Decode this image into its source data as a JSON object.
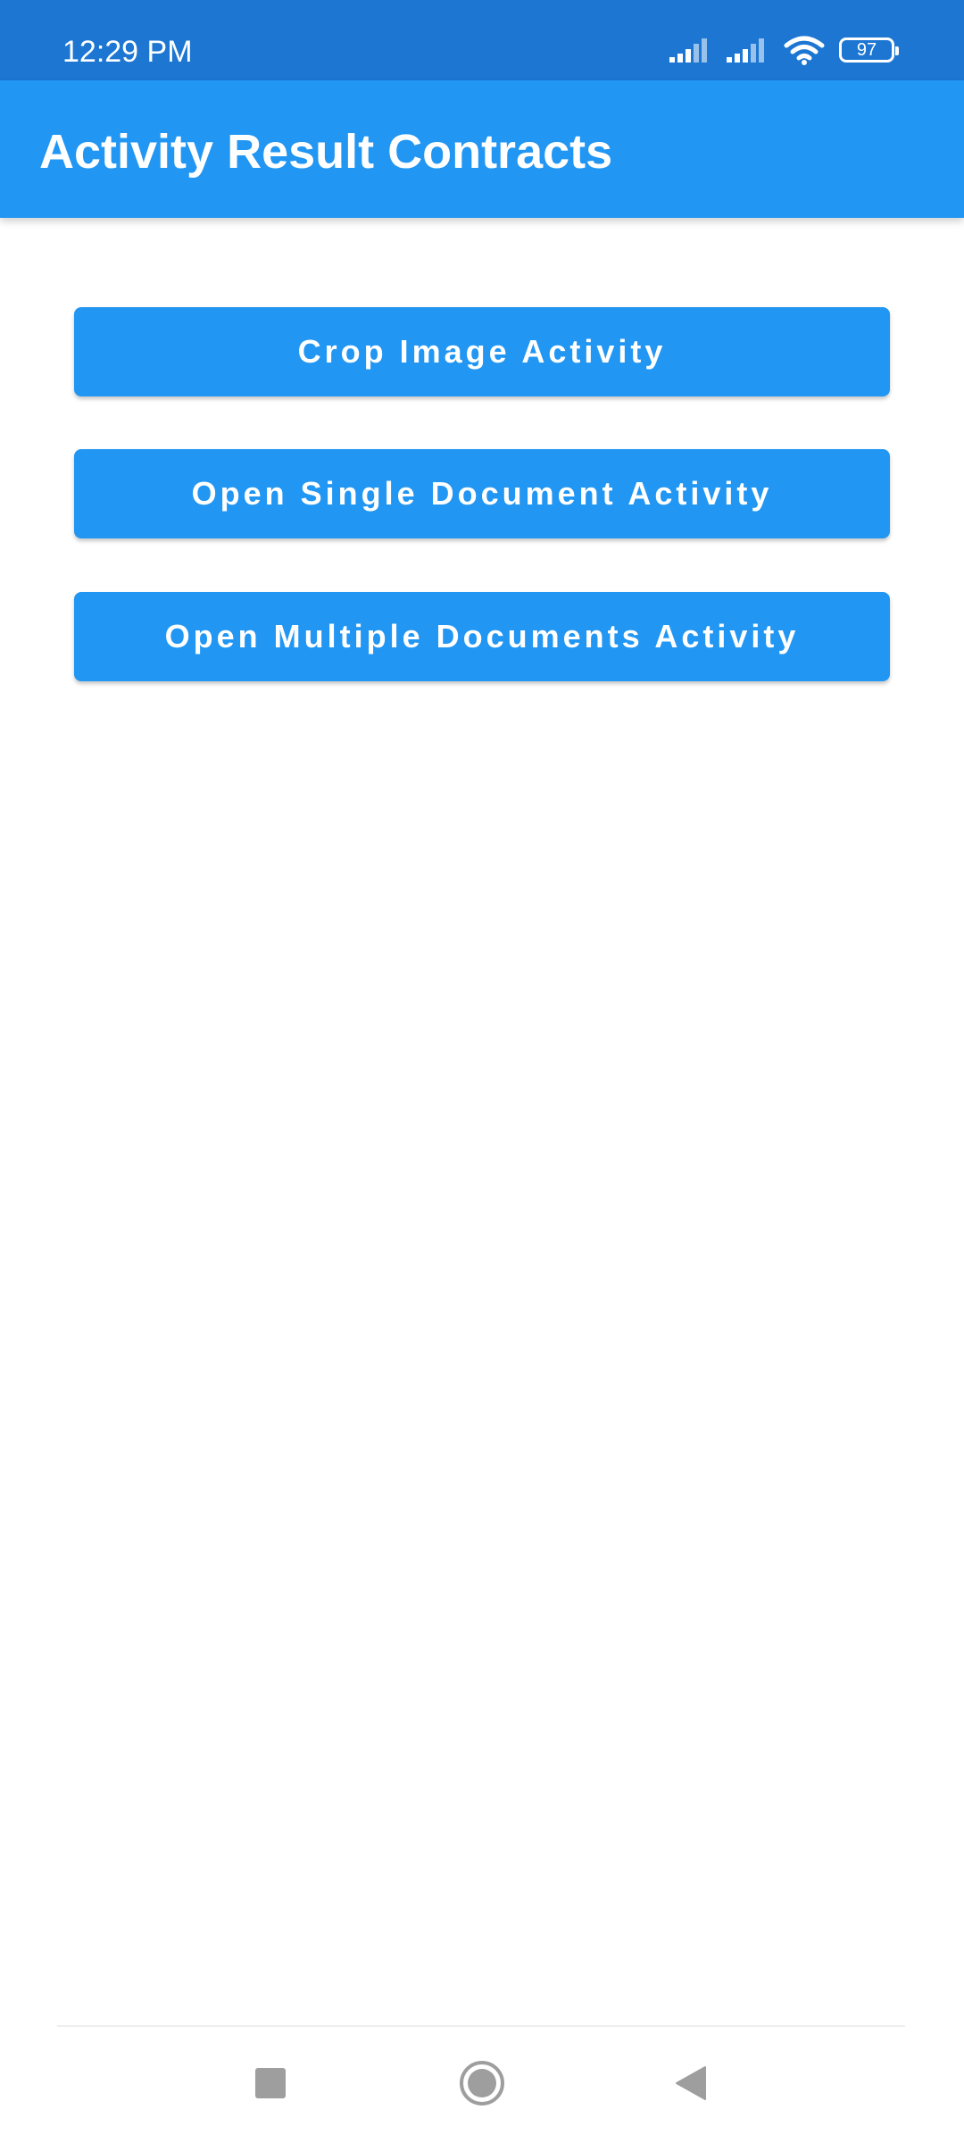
{
  "status_bar": {
    "time": "12:29 PM",
    "battery_level": "97",
    "icons": [
      "signal-icon",
      "signal-icon",
      "wifi-icon",
      "battery-icon"
    ]
  },
  "app_bar": {
    "title": "Activity Result Contracts"
  },
  "buttons": [
    {
      "label": "Crop Image Activity"
    },
    {
      "label": "Open Single Document Activity"
    },
    {
      "label": "Open Multiple Documents Activity"
    }
  ],
  "navigation": {
    "items": [
      "recents-icon",
      "home-icon",
      "back-icon"
    ]
  },
  "colors": {
    "status_bar": "#1C76D2",
    "primary": "#2196F3",
    "background": "#FFFFFF"
  }
}
